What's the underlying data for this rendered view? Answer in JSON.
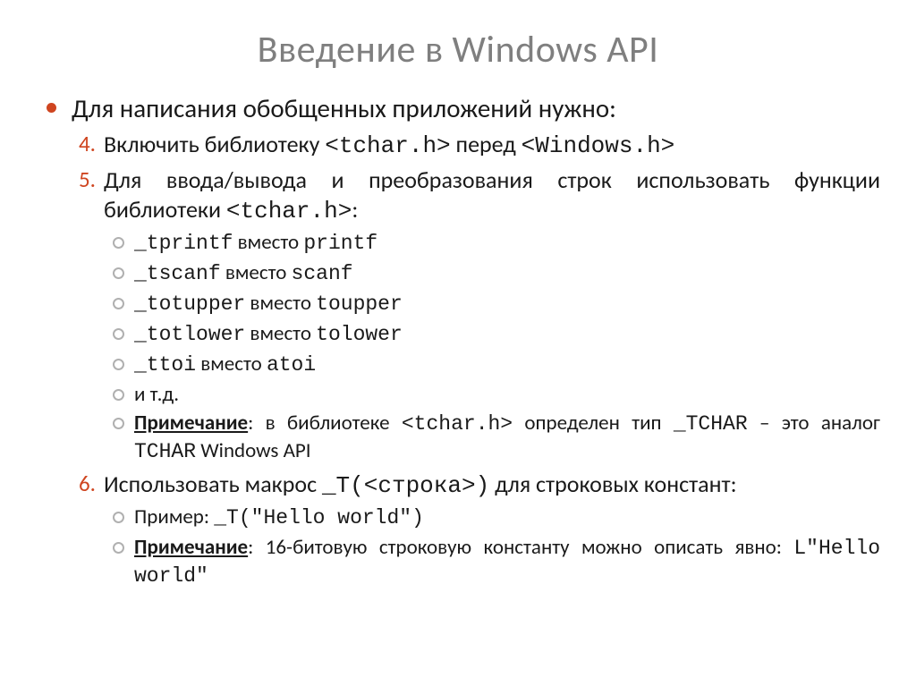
{
  "title": "Введение в Windows API",
  "main_item": "Для написания обобщенных приложений нужно:",
  "items": [
    {
      "num": "4.",
      "pre": "Включить библиотеку ",
      "code1": "<tchar.h>",
      "mid": " перед ",
      "code2": "<Windows.h>"
    },
    {
      "num": "5.",
      "pre": "Для ввода/вывода и преобразования строк использовать функции библиотеки ",
      "code1": "<tchar.h>",
      "post": ":"
    },
    {
      "num": "6.",
      "pre": "Использовать макрос ",
      "code1": "_T(<строка>)",
      "post": " для строковых констант:"
    }
  ],
  "sub5": [
    {
      "c1": "_tprintf",
      "t": " вместо ",
      "c2": "printf"
    },
    {
      "c1": "_tscanf",
      "t": " вместо ",
      "c2": "scanf"
    },
    {
      "c1": "_totupper",
      "t": " вместо ",
      "c2": "toupper"
    },
    {
      "c1": "_totlower",
      "t": " вместо ",
      "c2": "tolower"
    },
    {
      "c1": "_ttoi",
      "t": " вместо ",
      "c2": "atoi"
    },
    {
      "plain": "и т.д."
    }
  ],
  "note5": {
    "label": "Примечание",
    "t1": ": в библиотеке ",
    "c1": "<tchar.h>",
    "t2": " определен тип ",
    "c2": "_TCHAR",
    "t3": " – это аналог ",
    "c3": "TCHAR",
    "t4": " Windows API"
  },
  "sub6_example": {
    "label": "Пример: ",
    "code": "_T(\"Hello world\")"
  },
  "note6": {
    "label": "Примечание",
    "t1": ": 16-битовую строковую константу можно описать явно: ",
    "c1": "L\"Hello world\""
  }
}
